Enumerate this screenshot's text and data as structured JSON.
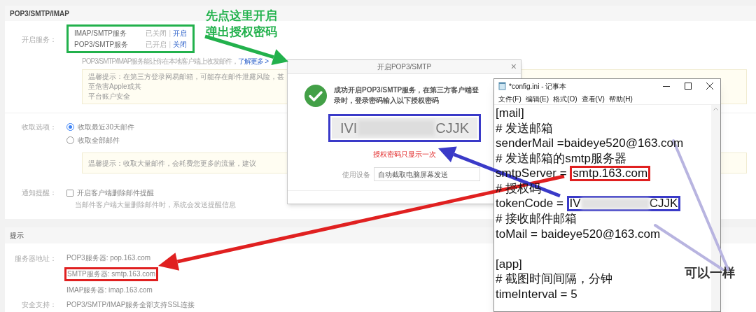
{
  "settings": {
    "section_title": "POP3/SMTP/IMAP",
    "services_label": "开启服务：",
    "services": [
      {
        "name": "IMAP/SMTP服务",
        "status": "已关闭",
        "separator": "|",
        "action": "开启"
      },
      {
        "name": "POP3/SMTP服务",
        "status": "已开启",
        "separator": "|",
        "action": "关闭"
      }
    ],
    "services_note": "POP3/SMTP/IMAP服务能让你在本地客户端上收发邮件，",
    "learn_more": "了解更多 >",
    "tip_lines": [
      "温馨提示：在第三方登录网易邮箱，可能存在邮件泄露风险，甚至危害Apple或其",
      "平台账户安全"
    ],
    "fetch_label": "收取选项：",
    "fetch_options": [
      {
        "label": "收取最近30天邮件",
        "selected": true
      },
      {
        "label": "收取全部邮件",
        "selected": false
      }
    ],
    "fetch_tip": "温馨提示：收取大量邮件，会耗费您更多的流量，建议",
    "notify_label": "通知提醒：",
    "notify": {
      "label": "开启客户端删除邮件提醒",
      "checked": false,
      "hint": "当邮件客户端大量删除邮件时，系统会发送提醒信息"
    }
  },
  "hints": {
    "section_title": "提示",
    "server_label": "服务器地址：",
    "servers": [
      {
        "text": "POP3服务器: pop.163.com",
        "framed": false
      },
      {
        "text": "SMTP服务器: smtp.163.com",
        "framed": true
      },
      {
        "text": "IMAP服务器: imap.163.com",
        "framed": false
      }
    ],
    "security_label": "安全支持：",
    "security": "POP3/SMTP/IMAP服务全部支持SSL连接"
  },
  "dialog": {
    "title": "开启POP3/SMTP",
    "close": "×",
    "message": "成功开启POP3/SMTP服务，在第三方客户端登录时，登录密码输入以下授权密码",
    "token_start": "IVI",
    "token_end": "CJJK",
    "token_note": "授权密码只显示一次",
    "device_label": "使用设备",
    "device_value": "自动截取电脑屏幕发送"
  },
  "notepad": {
    "title": "*config.ini - 记事本",
    "menu": [
      "文件(F)",
      "编辑(E)",
      "格式(O)",
      "查看(V)",
      "帮助(H)"
    ],
    "lines": [
      {
        "kind": "text",
        "text": "[mail]"
      },
      {
        "kind": "text",
        "text": "# 发送邮箱"
      },
      {
        "kind": "text",
        "text": "senderMail =baideye520@163.com"
      },
      {
        "kind": "text",
        "text": "# 发送邮箱的smtp服务器"
      },
      {
        "kind": "framed",
        "text": "smtpServer = ",
        "value": "smtp.163.com"
      },
      {
        "kind": "text",
        "text": "# 授权码"
      },
      {
        "kind": "token",
        "text": "tokenCode = ",
        "value_start": "IV",
        "value_end": "CJJK"
      },
      {
        "kind": "text",
        "text": "# 接收邮件邮箱"
      },
      {
        "kind": "text",
        "text": "toMail = baideye520@163.com"
      },
      {
        "kind": "blank"
      },
      {
        "kind": "text",
        "text": "[app]"
      },
      {
        "kind": "text",
        "text": "# 截图时间间隔，分钟"
      },
      {
        "kind": "text",
        "text": "timeInterval = 5"
      }
    ]
  },
  "annotations": {
    "open_note": [
      "先点这里开启",
      "弹出授权密码"
    ],
    "same_note": "可以一样"
  }
}
